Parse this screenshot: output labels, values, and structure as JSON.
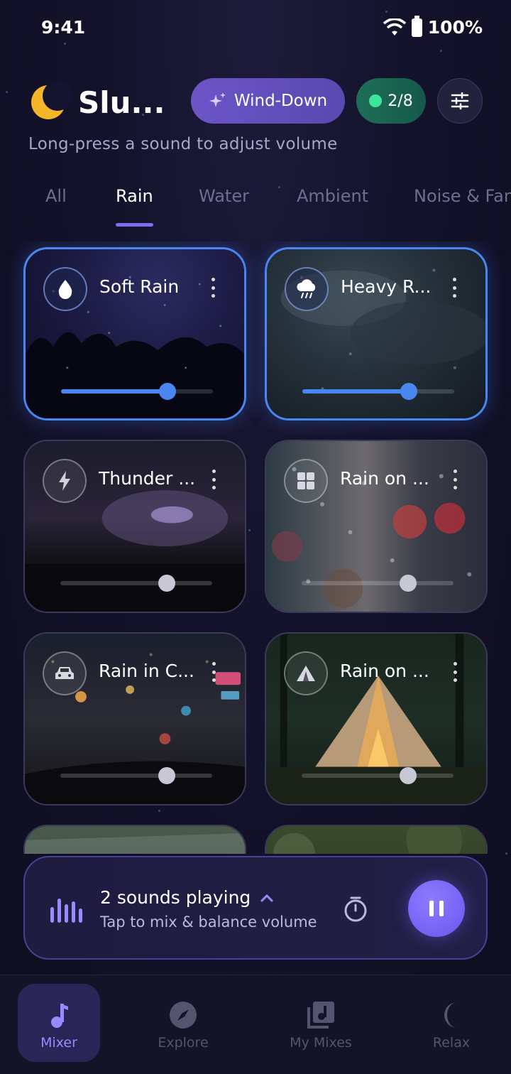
{
  "status_bar": {
    "time": "9:41",
    "battery": "100%"
  },
  "header": {
    "title": "Slu...",
    "wind_down_label": "Wind-Down",
    "playing_count": "2/8",
    "subtitle": "Long-press a sound to adjust volume"
  },
  "tabs": [
    {
      "label": "All",
      "active": false
    },
    {
      "label": "Rain",
      "active": true
    },
    {
      "label": "Water",
      "active": false
    },
    {
      "label": "Ambient",
      "active": false
    },
    {
      "label": "Noise & Fan",
      "active": false
    }
  ],
  "sounds": [
    {
      "name": "Soft Rain",
      "icon": "water-drop-icon",
      "active": true,
      "volume": 0.7
    },
    {
      "name": "Heavy R...",
      "icon": "storm-cloud-icon",
      "active": true,
      "volume": 0.7
    },
    {
      "name": "Thunder ...",
      "icon": "lightning-icon",
      "active": false,
      "volume": 0.7
    },
    {
      "name": "Rain on ...",
      "icon": "window-icon",
      "active": false,
      "volume": 0.7
    },
    {
      "name": "Rain in C...",
      "icon": "car-icon",
      "active": false,
      "volume": 0.7
    },
    {
      "name": "Rain on ...",
      "icon": "tent-icon",
      "active": false,
      "volume": 0.7
    }
  ],
  "player": {
    "title": "2 sounds playing",
    "subtitle": "Tap to mix & balance volume"
  },
  "nav": [
    {
      "label": "Mixer",
      "icon": "music-note-icon",
      "active": true
    },
    {
      "label": "Explore",
      "icon": "compass-icon",
      "active": false
    },
    {
      "label": "My Mixes",
      "icon": "library-music-icon",
      "active": false
    },
    {
      "label": "Relax",
      "icon": "crescent-moon-icon",
      "active": false
    }
  ],
  "colors": {
    "accent": "#7c6cf2",
    "active_card_border": "#4a86f0",
    "playing_dot": "#3fe59b",
    "background": "#100f22"
  }
}
